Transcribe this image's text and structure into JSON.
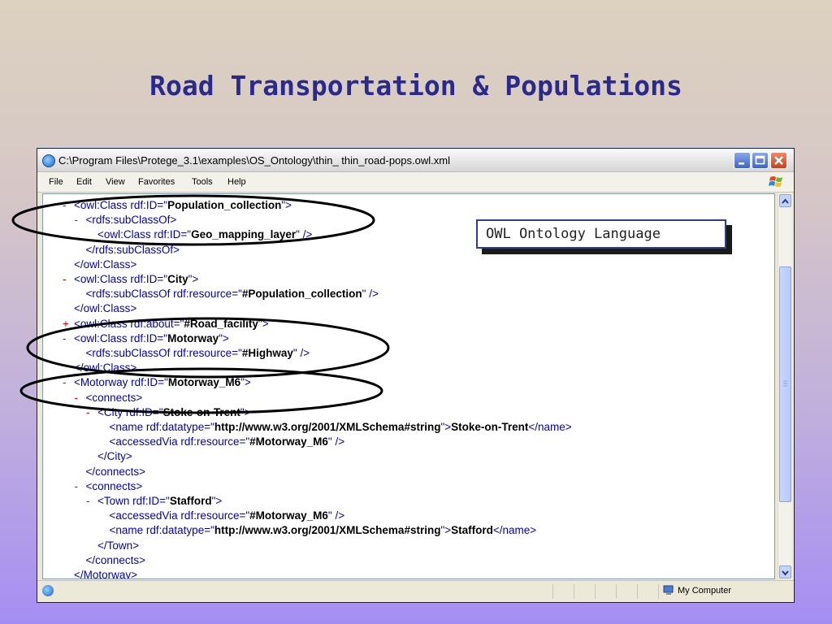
{
  "slide": {
    "title": "Road Transportation & Populations",
    "callout": "OWL Ontology Language"
  },
  "window": {
    "title": "C:\\Program Files\\Protege_3.1\\examples\\OS_Ontology\\thin_ thin_road-pops.owl.xml",
    "menu": [
      "File",
      "Edit",
      "View",
      "Favorites",
      "Tools",
      "Help"
    ],
    "status": {
      "zone": "My Computer"
    }
  },
  "xml": [
    {
      "t": "-",
      "parts": [
        [
          "tag",
          "<owl:Class rdf:ID=\""
        ],
        [
          "val",
          "Population_collection"
        ],
        [
          "tag",
          "\">"
        ]
      ],
      "indent": 0
    },
    {
      "t": "-",
      "parts": [
        [
          "tag",
          "<rdfs:subClassOf>"
        ]
      ],
      "indent": 1
    },
    {
      "t": "",
      "parts": [
        [
          "tag",
          "<owl:Class rdf:ID=\""
        ],
        [
          "val",
          "Geo_mapping_layer"
        ],
        [
          "tag",
          "\" />"
        ]
      ],
      "indent": 2
    },
    {
      "t": "",
      "parts": [
        [
          "tag",
          "</rdfs:subClassOf>"
        ]
      ],
      "indent": 1
    },
    {
      "t": "",
      "parts": [
        [
          "tag",
          "</owl:Class>"
        ]
      ],
      "indent": 0
    },
    {
      "t": "-",
      "parts": [
        [
          "tag",
          "<owl:Class rdf:ID=\""
        ],
        [
          "val",
          "City"
        ],
        [
          "tag",
          "\">"
        ]
      ],
      "indent": 0
    },
    {
      "t": "",
      "parts": [
        [
          "tag",
          "<rdfs:subClassOf rdf:resource=\""
        ],
        [
          "val",
          "#Population_collection"
        ],
        [
          "tag",
          "\" />"
        ]
      ],
      "indent": 1
    },
    {
      "t": "",
      "parts": [
        [
          "tag",
          "</owl:Class>"
        ]
      ],
      "indent": 0
    },
    {
      "t": "+",
      "parts": [
        [
          "tag",
          "<owl:Class rdf:about=\""
        ],
        [
          "val",
          "#Road_facility"
        ],
        [
          "tag",
          "\">"
        ]
      ],
      "indent": 0
    },
    {
      "t": "-",
      "parts": [
        [
          "tag",
          "<owl:Class rdf:ID=\""
        ],
        [
          "val",
          "Motorway"
        ],
        [
          "tag",
          "\">"
        ]
      ],
      "indent": 0
    },
    {
      "t": "",
      "parts": [
        [
          "tag",
          "<rdfs:subClassOf rdf:resource=\""
        ],
        [
          "val",
          "#Highway"
        ],
        [
          "tag",
          "\" />"
        ]
      ],
      "indent": 1
    },
    {
      "t": "",
      "parts": [
        [
          "tag",
          "</owl:Class>"
        ]
      ],
      "indent": 0
    },
    {
      "t": "-",
      "parts": [
        [
          "tag",
          "<Motorway rdf:ID=\""
        ],
        [
          "val",
          "Motorway_M6"
        ],
        [
          "tag",
          "\">"
        ]
      ],
      "indent": 0
    },
    {
      "t": "-",
      "parts": [
        [
          "tag",
          "<connects>"
        ]
      ],
      "indent": 1
    },
    {
      "t": "-",
      "parts": [
        [
          "tag",
          "<City rdf:ID=\""
        ],
        [
          "val",
          "Stoke-on-Trent"
        ],
        [
          "tag",
          "\">"
        ]
      ],
      "indent": 2
    },
    {
      "t": "",
      "parts": [
        [
          "tag",
          "<name rdf:datatype=\""
        ],
        [
          "val",
          "http://www.w3.org/2001/XMLSchema#string"
        ],
        [
          "tag",
          "\">"
        ],
        [
          "txt",
          "Stoke-on-Trent"
        ],
        [
          "tag",
          "</name>"
        ]
      ],
      "indent": 3
    },
    {
      "t": "",
      "parts": [
        [
          "tag",
          "<accessedVia rdf:resource=\""
        ],
        [
          "val",
          "#Motorway_M6"
        ],
        [
          "tag",
          "\" />"
        ]
      ],
      "indent": 3
    },
    {
      "t": "",
      "parts": [
        [
          "tag",
          "</City>"
        ]
      ],
      "indent": 2
    },
    {
      "t": "",
      "parts": [
        [
          "tag",
          "</connects>"
        ]
      ],
      "indent": 1
    },
    {
      "t": "-",
      "parts": [
        [
          "tag",
          "<connects>"
        ]
      ],
      "indent": 1
    },
    {
      "t": "-",
      "parts": [
        [
          "tag",
          "<Town rdf:ID=\""
        ],
        [
          "val",
          "Stafford"
        ],
        [
          "tag",
          "\">"
        ]
      ],
      "indent": 2
    },
    {
      "t": "",
      "parts": [
        [
          "tag",
          "<accessedVia rdf:resource=\""
        ],
        [
          "val",
          "#Motorway_M6"
        ],
        [
          "tag",
          "\" />"
        ]
      ],
      "indent": 3
    },
    {
      "t": "",
      "parts": [
        [
          "tag",
          "<name rdf:datatype=\""
        ],
        [
          "val",
          "http://www.w3.org/2001/XMLSchema#string"
        ],
        [
          "tag",
          "\">"
        ],
        [
          "txt",
          "Stafford"
        ],
        [
          "tag",
          "</name>"
        ]
      ],
      "indent": 3
    },
    {
      "t": "",
      "parts": [
        [
          "tag",
          "</Town>"
        ]
      ],
      "indent": 2
    },
    {
      "t": "",
      "parts": [
        [
          "tag",
          "</connects>"
        ]
      ],
      "indent": 1
    },
    {
      "t": "",
      "parts": [
        [
          "tag",
          "</Motorway>"
        ]
      ],
      "indent": 0
    }
  ],
  "colors": {
    "tag": "#0000cc",
    "toggle": "#e00000",
    "title": "#2a2a8c"
  }
}
